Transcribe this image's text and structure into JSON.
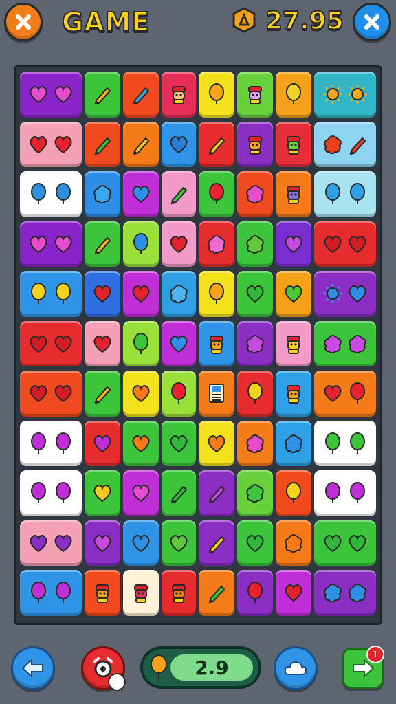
{
  "header": {
    "title": "GAME",
    "score": "27.95",
    "close_left_icon": "x-icon",
    "close_right_icon": "x-icon",
    "coin_icon": "hexagon-coin-icon"
  },
  "board": {
    "cols": 8,
    "rows": 11,
    "tiles": [
      [
        {
          "c": "#8a24c9",
          "i": [
            "heart",
            "heart"
          ],
          "ic": "#e64ccf"
        },
        {
          "c": "#3cc43a",
          "i": [
            "pencil"
          ],
          "ic": "#f2b21d"
        },
        {
          "c": "#f04a1e",
          "i": [
            "pencil"
          ],
          "ic": "#2fa7e9"
        },
        {
          "c": "#e62e58",
          "i": [
            "face"
          ],
          "ic": "#f5c38a"
        },
        {
          "c": "#f3e21b",
          "i": [
            "balloon"
          ],
          "ic": "#f4a51b"
        },
        {
          "c": "#66d13a",
          "i": [
            "face"
          ],
          "ic": "#e0a0e8"
        },
        {
          "c": "#f5a21a",
          "i": [
            "balloon"
          ],
          "ic": "#f0d22a"
        },
        {
          "c": "#31b6c8",
          "i": [
            "sun",
            "sun"
          ],
          "ic": "#f2a81b"
        }
      ],
      [
        {
          "c": "#f4a0b5",
          "i": [
            "heart",
            "heart"
          ],
          "ic": "#e5222e"
        },
        {
          "c": "#f04a1e",
          "i": [
            "pencil"
          ],
          "ic": "#3bbd3a"
        },
        {
          "c": "#f57a18",
          "i": [
            "pencil"
          ],
          "ic": "#f2c91d"
        },
        {
          "c": "#2f94e6",
          "i": [
            "heart"
          ],
          "ic": "#2d7dd8"
        },
        {
          "c": "#e62c2c",
          "i": [
            "pencil"
          ],
          "ic": "#f4c51a"
        },
        {
          "c": "#8a2ec4",
          "i": [
            "face"
          ],
          "ic": "#f4a51b"
        },
        {
          "c": "#e62e3a",
          "i": [
            "face"
          ],
          "ic": "#6fd33e"
        },
        {
          "c": "#8ed3f0",
          "i": [
            "blob",
            "pencil"
          ],
          "ic": "#e8401e"
        }
      ],
      [
        {
          "c": "#ffffff",
          "i": [
            "balloon",
            "balloon"
          ],
          "ic": "#2d8fe0"
        },
        {
          "c": "#2f8fe6",
          "i": [
            "blob"
          ],
          "ic": "#3aa8f0"
        },
        {
          "c": "#c02ed8",
          "i": [
            "heart"
          ],
          "ic": "#2f8fe6"
        },
        {
          "c": "#f29ac8",
          "i": [
            "pencil"
          ],
          "ic": "#3bc43a"
        },
        {
          "c": "#3cc43a",
          "i": [
            "balloon"
          ],
          "ic": "#e5222e"
        },
        {
          "c": "#f04a1e",
          "i": [
            "blob"
          ],
          "ic": "#e84cc7"
        },
        {
          "c": "#f57a18",
          "i": [
            "face"
          ],
          "ic": "#8a6fd8"
        },
        {
          "c": "#a8e4f0",
          "i": [
            "balloon",
            "balloon"
          ],
          "ic": "#2fa0e6"
        }
      ],
      [
        {
          "c": "#8a24c9",
          "i": [
            "heart",
            "heart"
          ],
          "ic": "#e64ccf"
        },
        {
          "c": "#3cc43a",
          "i": [
            "pencil"
          ],
          "ic": "#f2b21d"
        },
        {
          "c": "#9ae03a",
          "i": [
            "balloon"
          ],
          "ic": "#2f8fe6"
        },
        {
          "c": "#f29ac8",
          "i": [
            "heart"
          ],
          "ic": "#e5222e"
        },
        {
          "c": "#e62c2c",
          "i": [
            "blob"
          ],
          "ic": "#f06bd0"
        },
        {
          "c": "#3cc43a",
          "i": [
            "blob"
          ],
          "ic": "#5ec93a"
        },
        {
          "c": "#7a2ed0",
          "i": [
            "heart"
          ],
          "ic": "#c74be0"
        },
        {
          "c": "#e62c2c",
          "i": [
            "heart",
            "heart"
          ],
          "ic": "#d31c25"
        }
      ],
      [
        {
          "c": "#2f94e6",
          "i": [
            "balloon",
            "balloon"
          ],
          "ic": "#f2d21d"
        },
        {
          "c": "#2f6fe0",
          "i": [
            "heart"
          ],
          "ic": "#e5222e"
        },
        {
          "c": "#c02ed8",
          "i": [
            "heart"
          ],
          "ic": "#e5222e"
        },
        {
          "c": "#2fa0e6",
          "i": [
            "blob"
          ],
          "ic": "#4fb5f0"
        },
        {
          "c": "#f3e21b",
          "i": [
            "balloon"
          ],
          "ic": "#f4a51b"
        },
        {
          "c": "#3cc43a",
          "i": [
            "heart"
          ],
          "ic": "#2fb83a"
        },
        {
          "c": "#f5a21a",
          "i": [
            "heart"
          ],
          "ic": "#49c83a"
        },
        {
          "c": "#8a2ec4",
          "i": [
            "sun",
            "heart"
          ],
          "ic": "#2f8fe6"
        }
      ],
      [
        {
          "c": "#e62c2c",
          "i": [
            "heart",
            "heart"
          ],
          "ic": "#d31c25"
        },
        {
          "c": "#f4a0b5",
          "i": [
            "heart"
          ],
          "ic": "#e5222e"
        },
        {
          "c": "#9ae03a",
          "i": [
            "balloon"
          ],
          "ic": "#3cc43a"
        },
        {
          "c": "#c02ed8",
          "i": [
            "heart"
          ],
          "ic": "#2f8fe6"
        },
        {
          "c": "#2f94e6",
          "i": [
            "face"
          ],
          "ic": "#f4a51b"
        },
        {
          "c": "#8a2ec4",
          "i": [
            "blob"
          ],
          "ic": "#c74be0"
        },
        {
          "c": "#f29ac8",
          "i": [
            "face"
          ],
          "ic": "#f2d21d"
        },
        {
          "c": "#3cc43a",
          "i": [
            "blob",
            "blob"
          ],
          "ic": "#c74be0"
        }
      ],
      [
        {
          "c": "#f04a1e",
          "i": [
            "heart",
            "heart"
          ],
          "ic": "#d31c25"
        },
        {
          "c": "#3cc43a",
          "i": [
            "pencil"
          ],
          "ic": "#f2b21d"
        },
        {
          "c": "#f3e21b",
          "i": [
            "heart"
          ],
          "ic": "#f57a18"
        },
        {
          "c": "#9ae03a",
          "i": [
            "balloon"
          ],
          "ic": "#e5222e"
        },
        {
          "c": "#f57a18",
          "i": [
            "card"
          ],
          "ic": "#2f94e6"
        },
        {
          "c": "#e62c2c",
          "i": [
            "balloon"
          ],
          "ic": "#f2d21d"
        },
        {
          "c": "#2fa0e6",
          "i": [
            "face"
          ],
          "ic": "#f4a51b"
        },
        {
          "c": "#f57a18",
          "i": [
            "heart",
            "balloon"
          ],
          "ic": "#e5222e"
        }
      ],
      [
        {
          "c": "#ffffff",
          "i": [
            "balloon",
            "balloon"
          ],
          "ic": "#c02ed8"
        },
        {
          "c": "#e62c2c",
          "i": [
            "heart"
          ],
          "ic": "#c02ed8"
        },
        {
          "c": "#3cc43a",
          "i": [
            "heart"
          ],
          "ic": "#f57a18"
        },
        {
          "c": "#3cc43a",
          "i": [
            "heart"
          ],
          "ic": "#2fb83a"
        },
        {
          "c": "#f3e21b",
          "i": [
            "heart"
          ],
          "ic": "#f57a18"
        },
        {
          "c": "#f57a18",
          "i": [
            "blob"
          ],
          "ic": "#e84cc7"
        },
        {
          "c": "#2fa0e6",
          "i": [
            "blob"
          ],
          "ic": "#2f8fe6"
        },
        {
          "c": "#ffffff",
          "i": [
            "balloon",
            "balloon"
          ],
          "ic": "#3cc43a"
        }
      ],
      [
        {
          "c": "#ffffff",
          "i": [
            "balloon",
            "balloon"
          ],
          "ic": "#c02ed8"
        },
        {
          "c": "#3cc43a",
          "i": [
            "heart"
          ],
          "ic": "#f2c91d"
        },
        {
          "c": "#c02ed8",
          "i": [
            "heart"
          ],
          "ic": "#e64ccf"
        },
        {
          "c": "#3cc43a",
          "i": [
            "pencil"
          ],
          "ic": "#2fb83a"
        },
        {
          "c": "#8a2ec4",
          "i": [
            "pencil"
          ],
          "ic": "#c74be0"
        },
        {
          "c": "#66d13a",
          "i": [
            "blob"
          ],
          "ic": "#3cc43a"
        },
        {
          "c": "#f04a1e",
          "i": [
            "balloon"
          ],
          "ic": "#f2d21d"
        },
        {
          "c": "#ffffff",
          "i": [
            "balloon",
            "balloon"
          ],
          "ic": "#c02ed8"
        }
      ],
      [
        {
          "c": "#f4a0b5",
          "i": [
            "heart",
            "heart"
          ],
          "ic": "#8a2ec4"
        },
        {
          "c": "#8a2ec4",
          "i": [
            "heart"
          ],
          "ic": "#c74be0"
        },
        {
          "c": "#2f94e6",
          "i": [
            "heart"
          ],
          "ic": "#2f8fe6"
        },
        {
          "c": "#3cc43a",
          "i": [
            "heart"
          ],
          "ic": "#5ec93a"
        },
        {
          "c": "#8a2ec4",
          "i": [
            "pencil"
          ],
          "ic": "#f2c91d"
        },
        {
          "c": "#3cc43a",
          "i": [
            "heart"
          ],
          "ic": "#2fb83a"
        },
        {
          "c": "#f57a18",
          "i": [
            "blob"
          ],
          "ic": "#f57a18"
        },
        {
          "c": "#3cc43a",
          "i": [
            "heart",
            "heart"
          ],
          "ic": "#2fb83a"
        }
      ],
      [
        {
          "c": "#2f94e6",
          "i": [
            "balloon",
            "balloon"
          ],
          "ic": "#c02ed8"
        },
        {
          "c": "#f04a1e",
          "i": [
            "face"
          ],
          "ic": "#f4a51b"
        },
        {
          "c": "#fff2d8",
          "i": [
            "face"
          ],
          "ic": "#e62e58"
        },
        {
          "c": "#e62c2c",
          "i": [
            "face"
          ],
          "ic": "#f57a18"
        },
        {
          "c": "#f57a18",
          "i": [
            "pencil"
          ],
          "ic": "#3cc43a"
        },
        {
          "c": "#8a2ec4",
          "i": [
            "balloon"
          ],
          "ic": "#e5222e"
        },
        {
          "c": "#c02ed8",
          "i": [
            "heart"
          ],
          "ic": "#e5222e"
        },
        {
          "c": "#8a2ec4",
          "i": [
            "blob",
            "blob"
          ],
          "ic": "#2f8fe6"
        }
      ]
    ]
  },
  "footer": {
    "back_icon": "arrow-left-icon",
    "record_icon": "alarm-icon",
    "counter_value": "2.9",
    "counter_icon": "balloon-icon",
    "cloud_icon": "cloud-icon",
    "next_icon": "arrow-right-icon",
    "next_badge": "1"
  },
  "colors": {
    "background": "#5d6670",
    "title_yellow": "#ffd21a",
    "close_orange": "#f07d1a",
    "close_blue": "#1f8ee8"
  }
}
